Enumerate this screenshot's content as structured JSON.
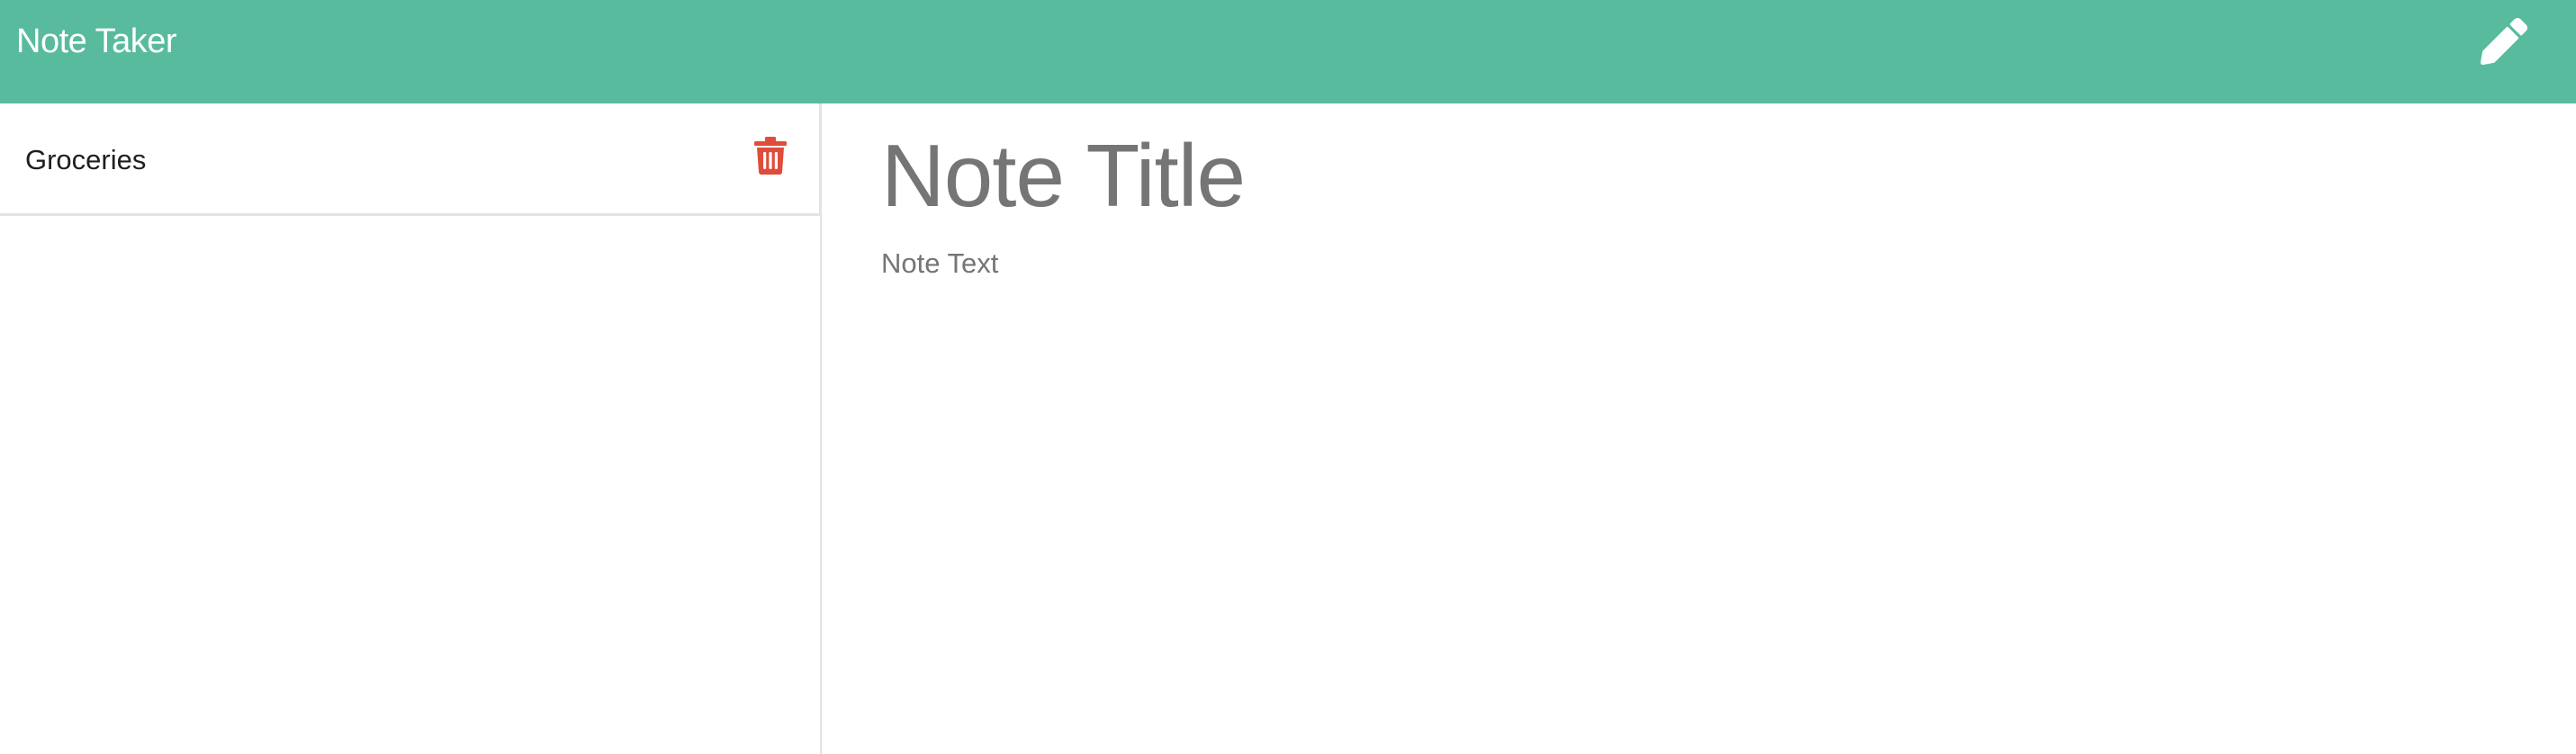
{
  "app": {
    "brand": "Note Taker",
    "header_color": "#58bb9e"
  },
  "toolbar": {
    "new_note_icon": "pencil-icon"
  },
  "sidebar": {
    "notes": [
      {
        "title": "Groceries",
        "delete_icon": "trash-icon",
        "delete_color": "#e04c3b"
      }
    ]
  },
  "editor": {
    "title_placeholder": "Note Title",
    "text_placeholder": "Note Text",
    "placeholder_color": "#757575"
  }
}
